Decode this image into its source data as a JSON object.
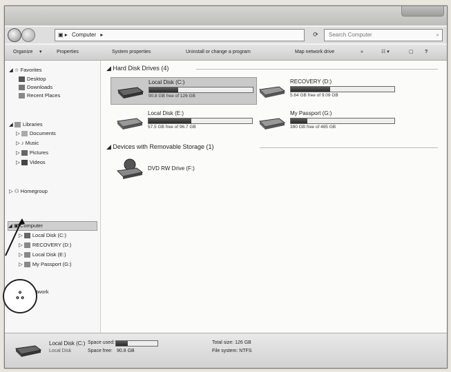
{
  "address": {
    "path_root": "Computer",
    "search_placeholder": "Search Computer"
  },
  "toolbar": {
    "organize": "Organize",
    "properties": "Properties",
    "system_properties": "System properties",
    "uninstall": "Uninstall or change a program",
    "map_drive": "Map network drive"
  },
  "nav": {
    "favorites": "Favorites",
    "desktop": "Desktop",
    "downloads": "Downloads",
    "recent": "Recent Places",
    "libraries": "Libraries",
    "documents": "Documents",
    "music": "Music",
    "pictures": "Pictures",
    "videos": "Videos",
    "homegroup": "Homegroup",
    "computer": "Computer",
    "local_c": "Local Disk (C:)",
    "recovery": "RECOVERY (D:)",
    "local_e": "Local Disk (E:)",
    "passport": "My Passport (G:)",
    "network": "Network"
  },
  "content": {
    "hdd_group": "Hard Disk Drives (4)",
    "removable_group": "Devices with Removable Storage (1)",
    "drives": [
      {
        "name": "Local Disk (C:)",
        "free": "90.8 GB free of 126 GB",
        "used_fraction": 0.28
      },
      {
        "name": "RECOVERY (D:)",
        "free": "5.64 GB free of 9.09 GB",
        "used_fraction": 0.38
      },
      {
        "name": "Local Disk (E:)",
        "free": "57.5 GB free of 96.7 GB",
        "used_fraction": 0.41
      },
      {
        "name": "My Passport (G:)",
        "free": "390 GB free of 465 GB",
        "used_fraction": 0.16
      }
    ],
    "dvd": "DVD RW Drive (F:)"
  },
  "status": {
    "title": "Local Disk (C:)",
    "subtitle": "Local Disk",
    "space_used_label": "Space used:",
    "space_free_label": "Space free:",
    "space_free_value": "90.8 GB",
    "total_size": "Total size: 126 GB",
    "filesystem": "File system: NTFS",
    "used_fraction": 0.28
  },
  "callout": {
    "text": "ஃ"
  }
}
